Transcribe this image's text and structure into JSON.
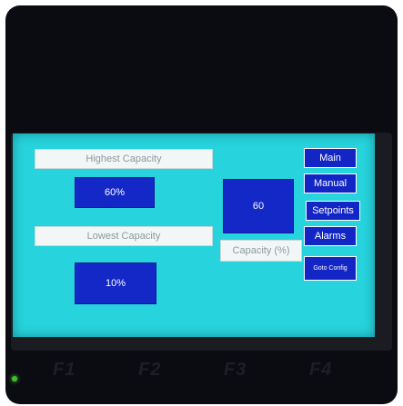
{
  "panel": {
    "highest_label": "Highest Capacity",
    "highest_value": "60%",
    "lowest_label": "Lowest Capacity",
    "lowest_value": "10%",
    "capacity_value": "60",
    "capacity_label": "Capacity (%)"
  },
  "nav": {
    "main": "Main",
    "manual": "Manual",
    "setpoints": "Setpoints",
    "alarms": "Alarms",
    "goto_config": "Goto Config"
  },
  "fkeys": [
    "F1",
    "F2",
    "F3",
    "F4"
  ],
  "colors": {
    "screen_bg": "#27d3dc",
    "button_blue": "#1428c8",
    "led_green": "#3fbf2a"
  }
}
